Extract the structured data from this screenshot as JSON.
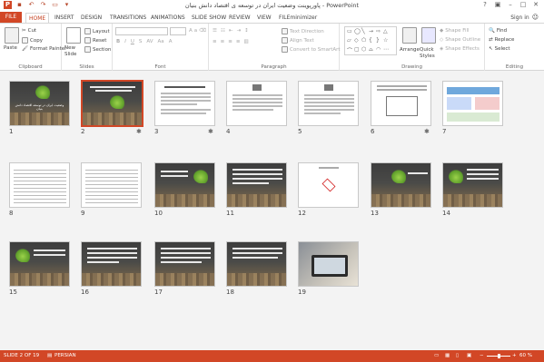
{
  "app": {
    "window_title": "پاورپوینت وضعیت ایران در توسعه ی اقتصاد دانش بنیان - PowerPoint",
    "sign_in": "Sign in"
  },
  "tabs": [
    "FILE",
    "HOME",
    "INSERT",
    "DESIGN",
    "TRANSITIONS",
    "ANIMATIONS",
    "SLIDE SHOW",
    "REVIEW",
    "VIEW",
    "FILEminimizer"
  ],
  "active_tab": "HOME",
  "ribbon": {
    "clipboard": {
      "paste": "Paste",
      "cut": "Cut",
      "copy": "Copy",
      "format_painter": "Format Painter",
      "label": "Clipboard"
    },
    "slides": {
      "new_slide": "New Slide",
      "layout": "Layout",
      "reset": "Reset",
      "section": "Section",
      "label": "Slides"
    },
    "font": {
      "label": "Font"
    },
    "paragraph": {
      "text_direction": "Text Direction",
      "align_text": "Align Text",
      "convert_smartart": "Convert to SmartArt",
      "label": "Paragraph"
    },
    "drawing": {
      "arrange": "Arrange",
      "quick_styles": "Quick Styles",
      "shape_fill": "Shape Fill",
      "shape_outline": "Shape Outline",
      "shape_effects": "Shape Effects",
      "label": "Drawing"
    },
    "editing": {
      "find": "Find",
      "replace": "Replace",
      "select": "Select",
      "label": "Editing"
    }
  },
  "slides": [
    {
      "n": "1",
      "style": "dark",
      "title": "وضعیت ایران در توسعه اقتصاد دانش بنیان"
    },
    {
      "n": "2",
      "style": "dark",
      "selected": true,
      "star": true
    },
    {
      "n": "3",
      "style": "white",
      "star": true
    },
    {
      "n": "4",
      "style": "white"
    },
    {
      "n": "5",
      "style": "white"
    },
    {
      "n": "6",
      "style": "white",
      "star": true
    },
    {
      "n": "7",
      "style": "white"
    },
    {
      "n": "8",
      "style": "white"
    },
    {
      "n": "9",
      "style": "white"
    },
    {
      "n": "10",
      "style": "dark"
    },
    {
      "n": "11",
      "style": "dark"
    },
    {
      "n": "12",
      "style": "white"
    },
    {
      "n": "13",
      "style": "dark"
    },
    {
      "n": "14",
      "style": "dark"
    },
    {
      "n": "15",
      "style": "dark"
    },
    {
      "n": "16",
      "style": "dark"
    },
    {
      "n": "17",
      "style": "dark"
    },
    {
      "n": "18",
      "style": "dark"
    },
    {
      "n": "19",
      "style": "photo"
    }
  ],
  "status": {
    "slide_info": "SLIDE 2 OF 19",
    "language": "PERSIAN",
    "zoom": "60 %"
  },
  "colors": {
    "accent": "#d24726"
  }
}
